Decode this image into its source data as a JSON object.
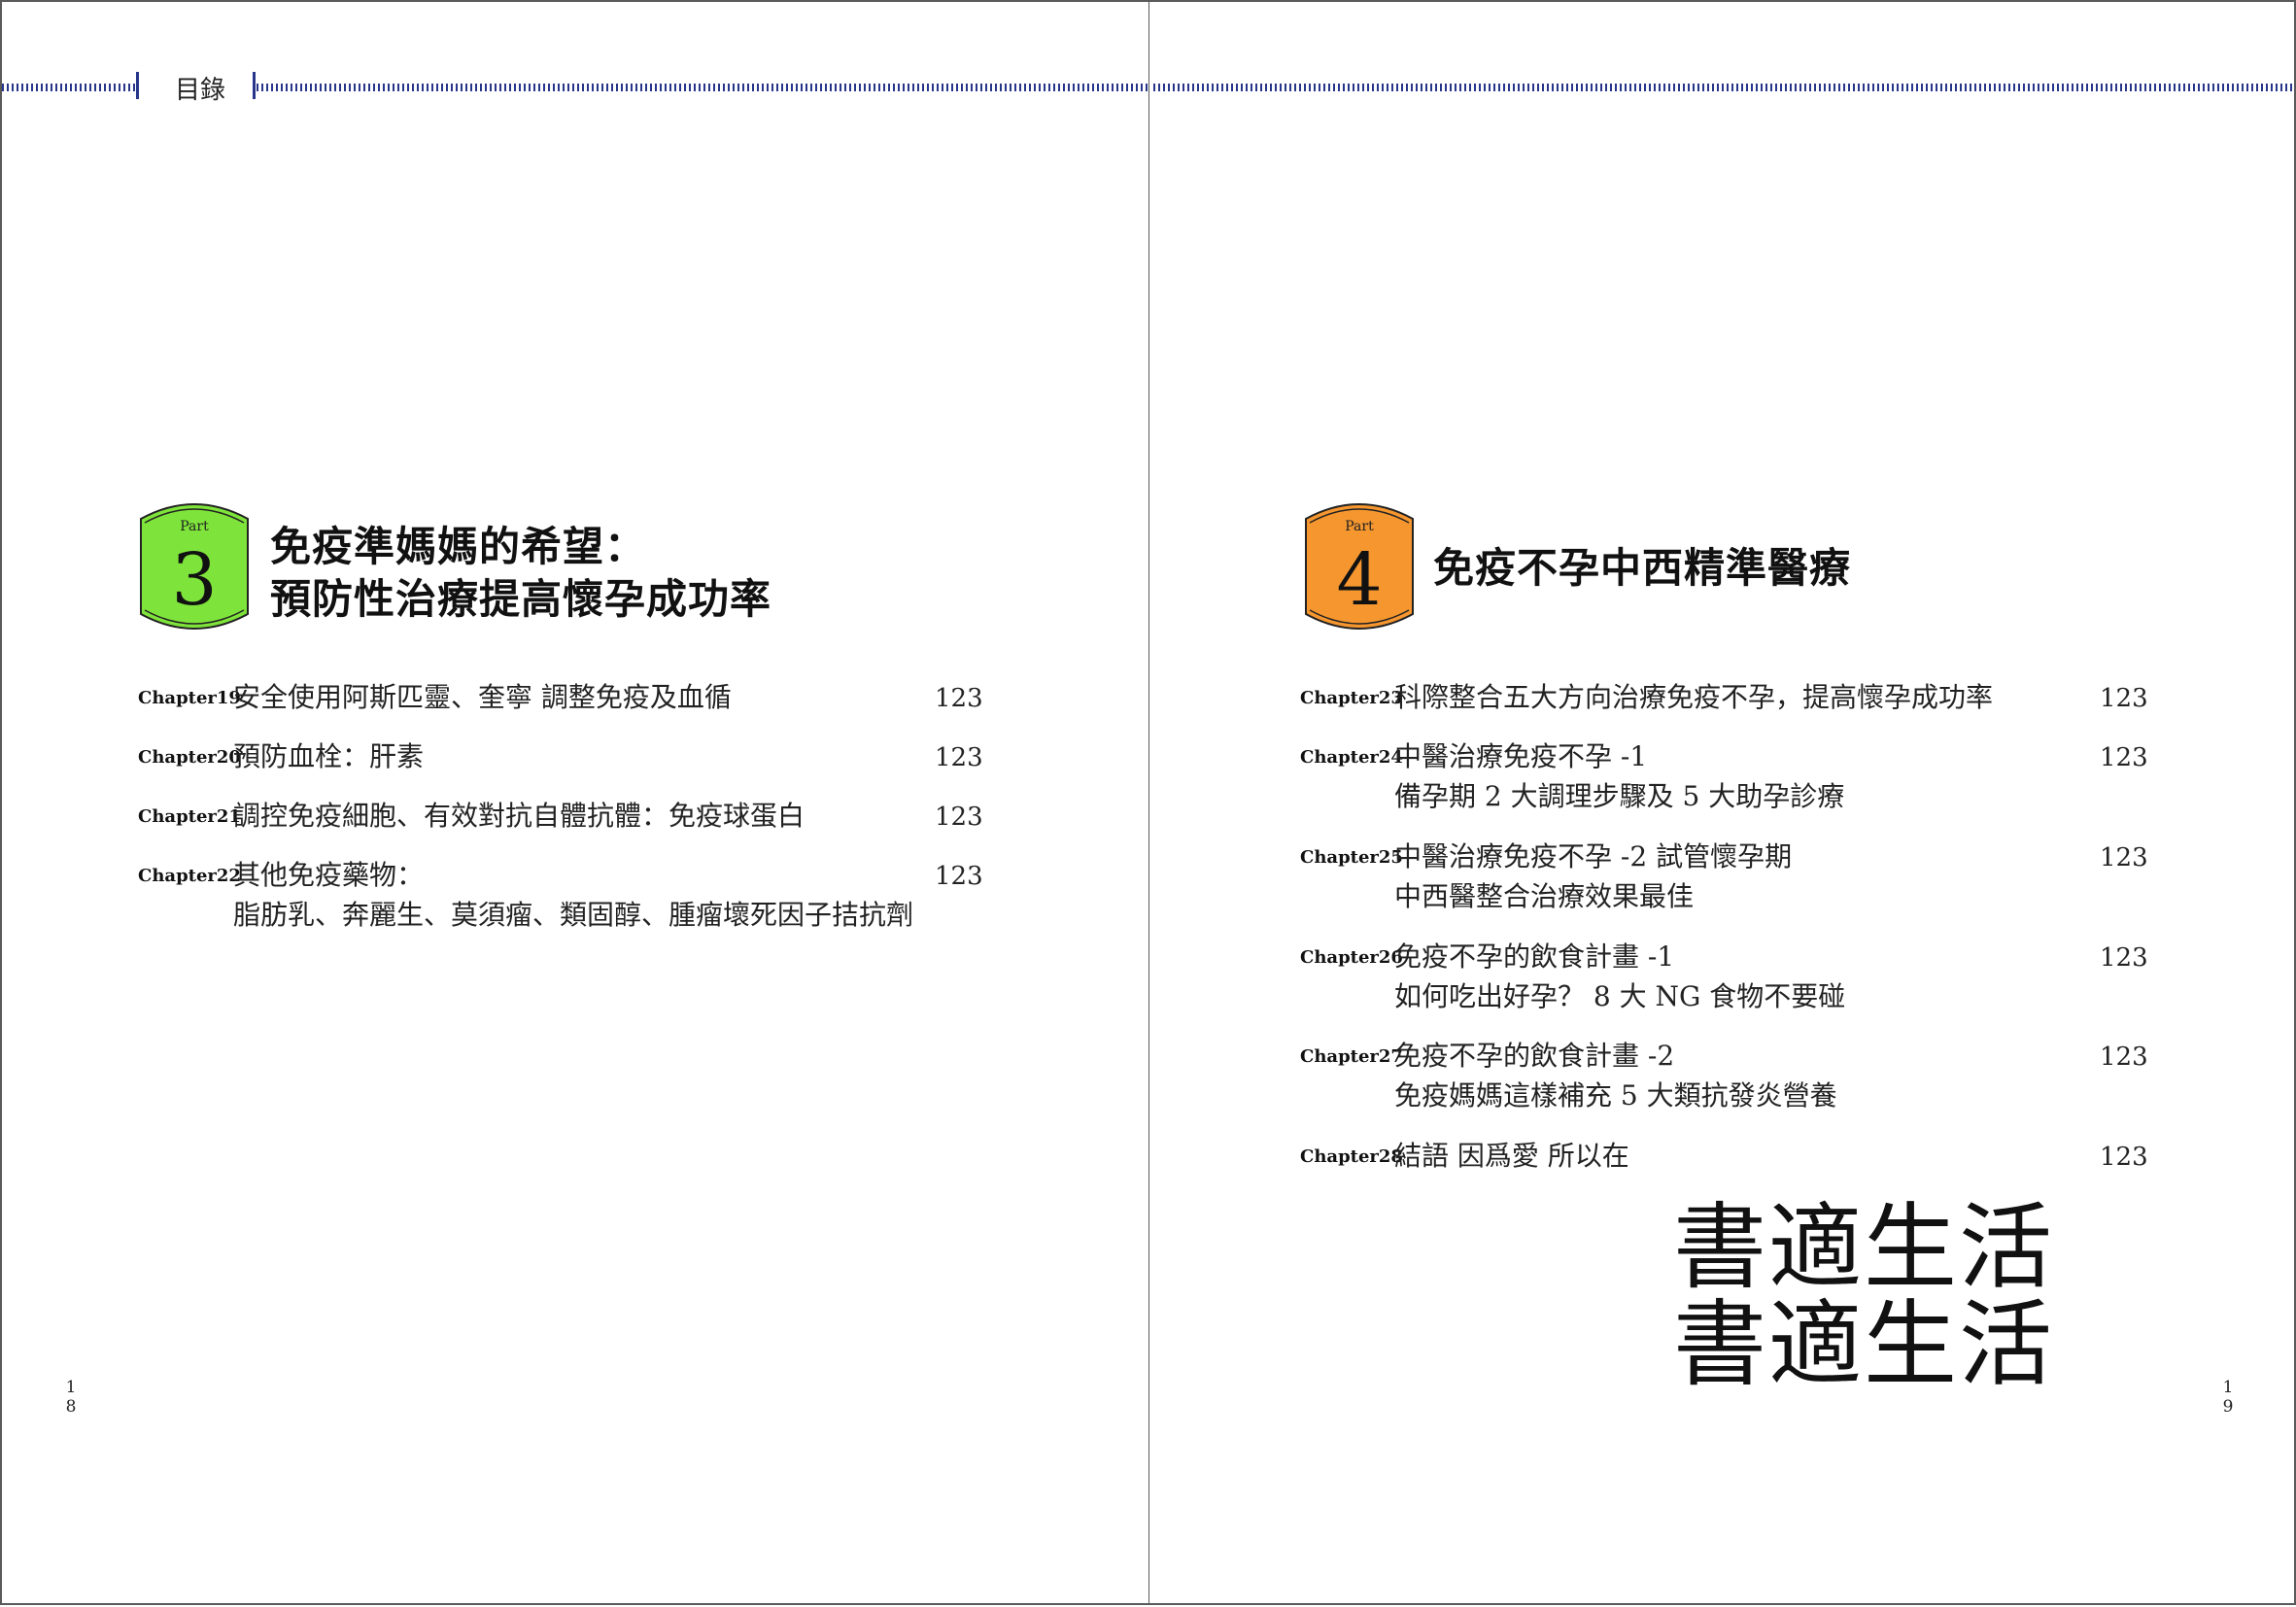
{
  "header": {
    "section_label": "目錄"
  },
  "left_page": {
    "part": {
      "word": "Part",
      "number": "3",
      "color": "#7ee33a",
      "title_line1": "免疫準媽媽的希望：",
      "title_line2": "預防性治療提高懷孕成功率"
    },
    "entries": [
      {
        "chapter": "Chapter19",
        "lines": [
          "安全使用阿斯匹靈、奎寧 調整免疫及血循"
        ],
        "page": "123"
      },
      {
        "chapter": "Chapter20",
        "lines": [
          "預防血栓：肝素"
        ],
        "page": "123"
      },
      {
        "chapter": "Chapter21",
        "lines": [
          "調控免疫細胞、有效對抗自體抗體：免疫球蛋白"
        ],
        "page": "123"
      },
      {
        "chapter": "Chapter22",
        "lines": [
          "其他免疫藥物：",
          "脂肪乳、奔麗生、莫須瘤、類固醇、腫瘤壞死因子拮抗劑"
        ],
        "page": "123"
      }
    ],
    "folio": [
      "1",
      "8"
    ]
  },
  "right_page": {
    "part": {
      "word": "Part",
      "number": "4",
      "color": "#f5962f",
      "title_line1": "免疫不孕中西精準醫療"
    },
    "entries": [
      {
        "chapter": "Chapter23",
        "lines": [
          "科際整合五大方向治療免疫不孕，提高懷孕成功率"
        ],
        "page": "123"
      },
      {
        "chapter": "Chapter24",
        "lines": [
          "中醫治療免疫不孕 -1",
          "備孕期  2 大調理步驟及 5 大助孕診療"
        ],
        "page": "123"
      },
      {
        "chapter": "Chapter25",
        "lines": [
          "中醫治療免疫不孕 -2 試管懷孕期",
          "中西醫整合治療效果最佳"
        ],
        "page": "123"
      },
      {
        "chapter": "Chapter26",
        "lines": [
          "免疫不孕的飲食計畫 -1",
          "如何吃出好孕？ 8 大 NG 食物不要碰"
        ],
        "page": "123"
      },
      {
        "chapter": "Chapter27",
        "lines": [
          "免疫不孕的飲食計畫 -2",
          "免疫媽媽這樣補充 5 大類抗發炎營養"
        ],
        "page": "123"
      },
      {
        "chapter": "Chapter28",
        "lines": [
          "結語  因爲愛  所以在"
        ],
        "page": "123"
      }
    ],
    "folio": [
      "1",
      "9"
    ],
    "watermark": [
      "書適生活",
      "書適生活"
    ]
  }
}
